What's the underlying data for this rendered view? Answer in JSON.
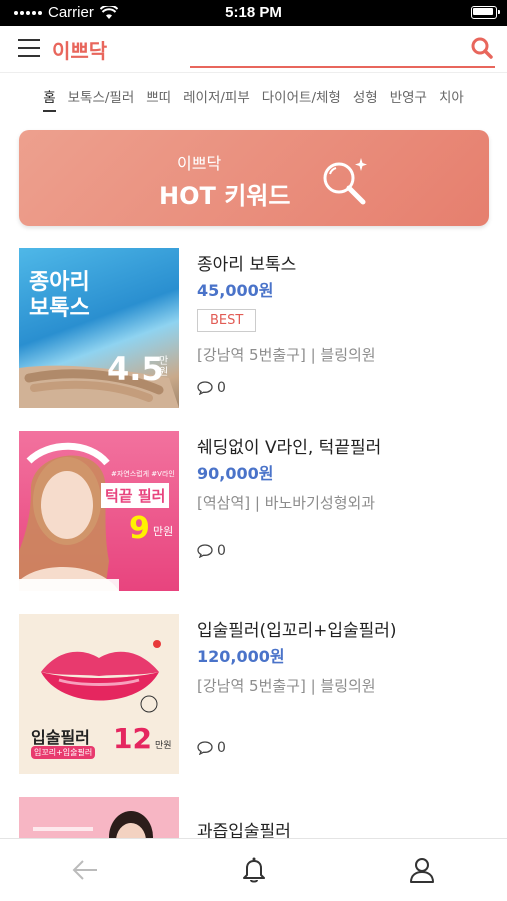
{
  "status": {
    "carrier": "Carrier",
    "time": "5:18 PM"
  },
  "header": {
    "logo": "이쁘닥",
    "search_placeholder": ""
  },
  "categories": [
    "홈",
    "보톡스/필러",
    "쁘띠",
    "레이저/피부",
    "다이어트/체형",
    "성형",
    "반영구",
    "치아"
  ],
  "banner": {
    "subtitle": "이쁘닥",
    "title": "HOT 키워드"
  },
  "items": [
    {
      "title": "종아리 보톡스",
      "price": "45,000원",
      "badge": "BEST",
      "location": "[강남역 5번출구] | 블링의원",
      "comments": "0",
      "thumb": {
        "line1": "종아리",
        "line2": "보톡스",
        "price_num": "4.5",
        "price_unit": "만원"
      }
    },
    {
      "title": "쉐딩없이 V라인, 턱끝필러",
      "price": "90,000원",
      "badge": "",
      "location": "[역삼역]  | 바노바기성형외과",
      "comments": "0",
      "thumb": {
        "top": "#자연스럽게 #V라인",
        "line1": "턱끝 필러",
        "price_num": "9",
        "price_unit": "만원"
      }
    },
    {
      "title": "입술필러(입꼬리+입술필러)",
      "price": "120,000원",
      "badge": "",
      "location": "[강남역 5번출구] | 블링의원",
      "comments": "0",
      "thumb": {
        "line1": "입술필러",
        "line2": "입꼬리+입술필러",
        "price_num": "12",
        "price_unit": "만원"
      }
    },
    {
      "title": "과즙입술필러",
      "price": "",
      "badge": "",
      "location": "",
      "comments": "",
      "thumb": {}
    }
  ]
}
